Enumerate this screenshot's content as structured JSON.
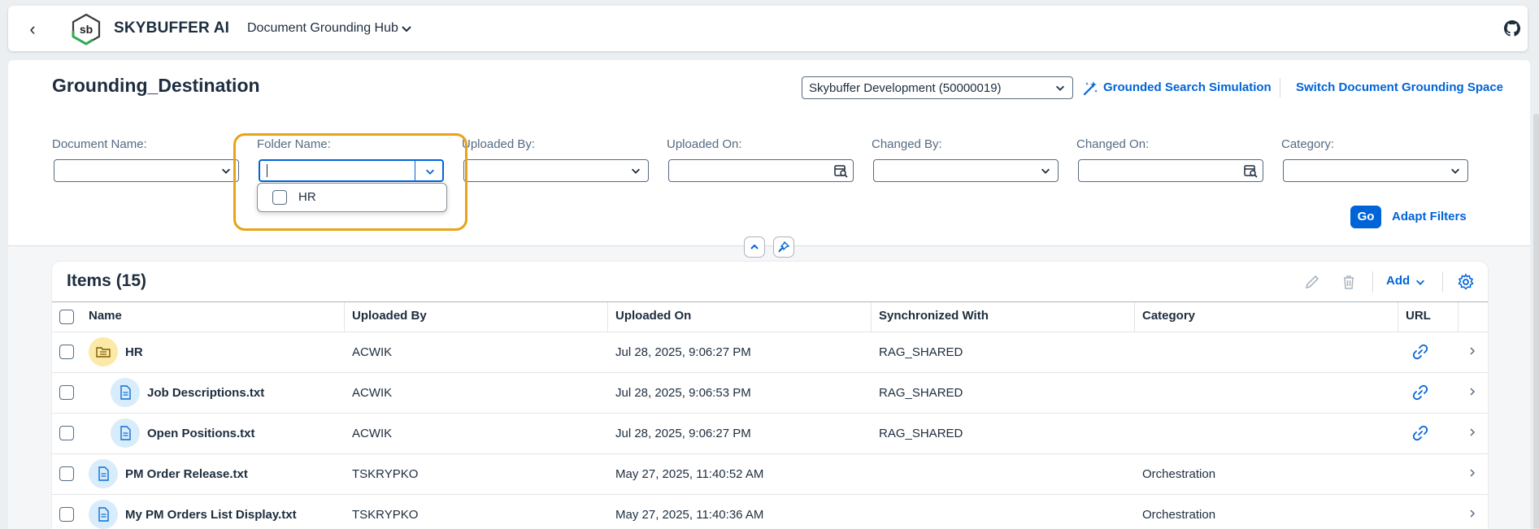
{
  "shell": {
    "brand": "SKYBUFFER AI",
    "app_title": "Document Grounding Hub",
    "logo_text": "sb"
  },
  "header": {
    "title": "Grounding_Destination",
    "space_select": "Skybuffer Development (50000019)",
    "simulation_link": "Grounded Search Simulation",
    "switch_link": "Switch Document Grounding Space"
  },
  "filters": {
    "fields": [
      {
        "label": "Document Name:",
        "type": "select"
      },
      {
        "label": "Folder Name:",
        "type": "select",
        "value": ""
      },
      {
        "label": "Uploaded By:",
        "type": "select"
      },
      {
        "label": "Uploaded On:",
        "type": "date"
      },
      {
        "label": "Changed By:",
        "type": "select"
      },
      {
        "label": "Changed On:",
        "type": "date"
      },
      {
        "label": "Category:",
        "type": "select"
      }
    ],
    "folder_options": [
      {
        "label": "HR",
        "checked": false
      }
    ],
    "go_label": "Go",
    "adapt_label": "Adapt Filters"
  },
  "table": {
    "title": "Items (15)",
    "add_label": "Add",
    "columns": [
      "Name",
      "Uploaded By",
      "Uploaded On",
      "Synchronized With",
      "Category",
      "URL"
    ],
    "rows": [
      {
        "name": "HR",
        "kind": "folder",
        "indent": 0,
        "uploaded_by": "ACWIK",
        "uploaded_on": "Jul 28, 2025, 9:06:27 PM",
        "sync": "RAG_SHARED",
        "category": "",
        "has_url": true
      },
      {
        "name": "Job Descriptions.txt",
        "kind": "doc",
        "indent": 1,
        "uploaded_by": "ACWIK",
        "uploaded_on": "Jul 28, 2025, 9:06:53 PM",
        "sync": "RAG_SHARED",
        "category": "",
        "has_url": true
      },
      {
        "name": "Open Positions.txt",
        "kind": "doc",
        "indent": 1,
        "uploaded_by": "ACWIK",
        "uploaded_on": "Jul 28, 2025, 9:06:27 PM",
        "sync": "RAG_SHARED",
        "category": "",
        "has_url": true
      },
      {
        "name": "PM Order Release.txt",
        "kind": "doc",
        "indent": 0,
        "uploaded_by": "TSKRYPKO",
        "uploaded_on": "May 27, 2025, 11:40:52 AM",
        "sync": "",
        "category": "Orchestration",
        "has_url": false
      },
      {
        "name": "My PM Orders List Display.txt",
        "kind": "doc",
        "indent": 0,
        "uploaded_by": "TSKRYPKO",
        "uploaded_on": "May 27, 2025, 11:40:36 AM",
        "sync": "",
        "category": "Orchestration",
        "has_url": false
      }
    ]
  },
  "colors": {
    "accent": "#0064d9",
    "highlight": "#e8a317",
    "folder_avatar": "#fde9a7",
    "doc_avatar": "#d8ecfb"
  },
  "icons": [
    "back-icon",
    "github-icon",
    "chevron-down-icon",
    "ai-sparkle-icon",
    "calendar-icon",
    "edit-icon",
    "delete-icon",
    "settings-icon",
    "link-icon",
    "folder-icon",
    "document-icon",
    "collapse-icon",
    "pin-icon",
    "navigation-arrow-icon"
  ]
}
